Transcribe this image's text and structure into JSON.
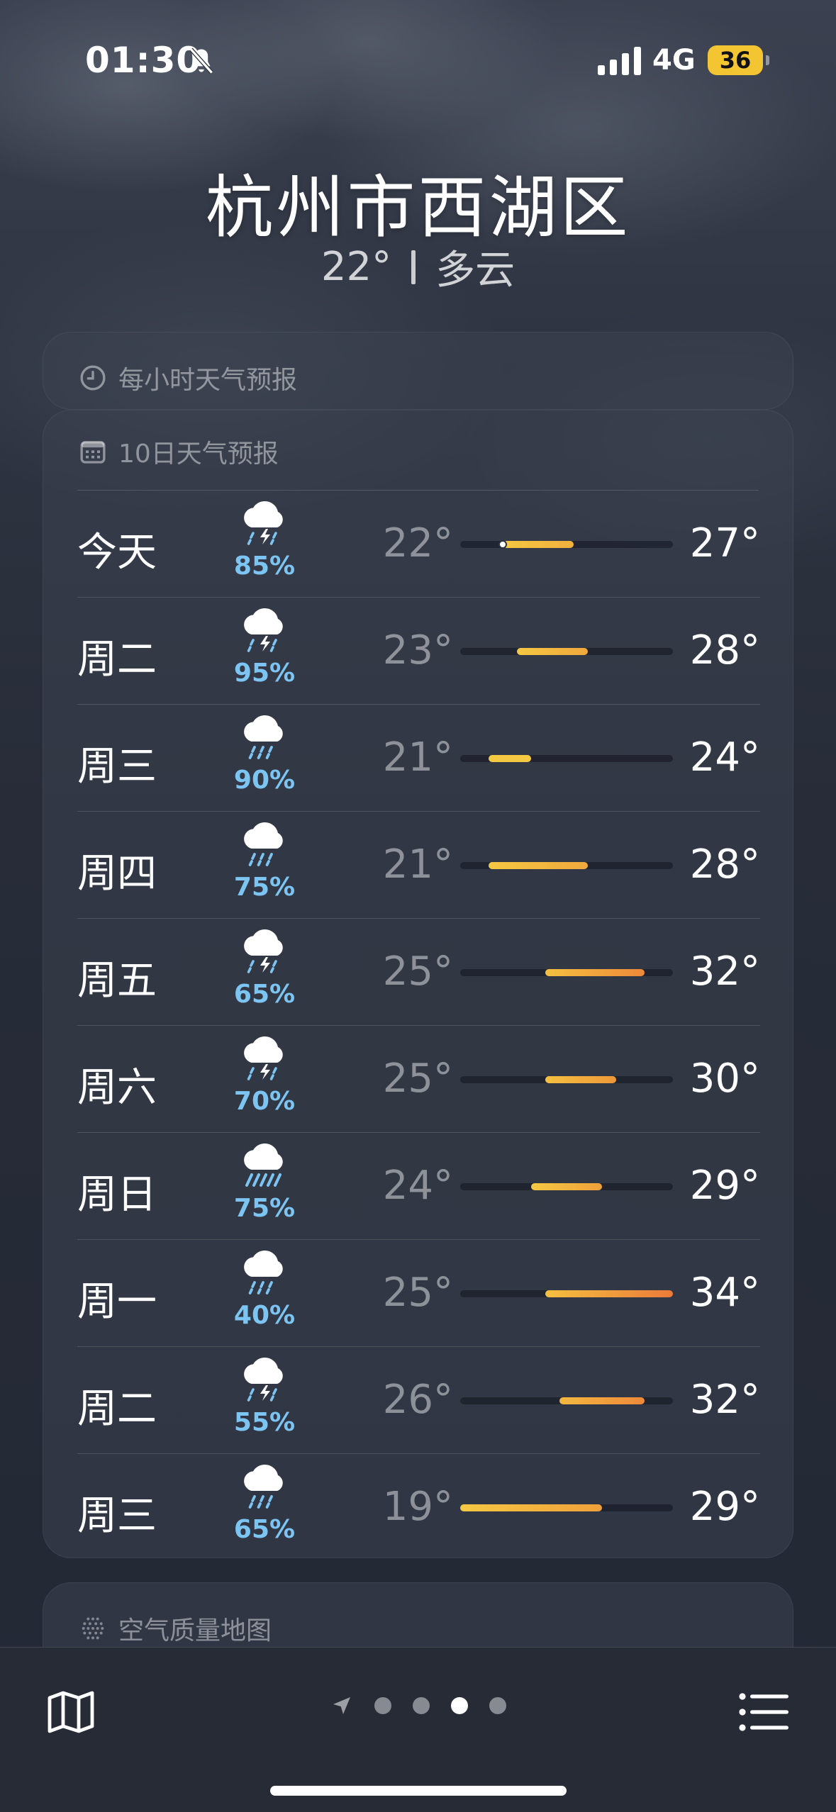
{
  "status": {
    "time": "01:30",
    "network": "4G",
    "battery": "36"
  },
  "header": {
    "city": "杭州市西湖区",
    "temp": "22°",
    "condition": "多云"
  },
  "hourly": {
    "label": "每小时天气预报"
  },
  "daily": {
    "label": "10日天气预报",
    "range_min": 19,
    "range_max": 34,
    "current_temp": 22,
    "days": [
      {
        "day": "今天",
        "icon": "thunderstorm-icon",
        "precip": "85%",
        "low": "22°",
        "high": "27°",
        "lo": 22,
        "hi": 27,
        "today": true
      },
      {
        "day": "周二",
        "icon": "thunderstorm-icon",
        "precip": "95%",
        "low": "23°",
        "high": "28°",
        "lo": 23,
        "hi": 28
      },
      {
        "day": "周三",
        "icon": "rain-icon",
        "precip": "90%",
        "low": "21°",
        "high": "24°",
        "lo": 21,
        "hi": 24
      },
      {
        "day": "周四",
        "icon": "rain-icon",
        "precip": "75%",
        "low": "21°",
        "high": "28°",
        "lo": 21,
        "hi": 28
      },
      {
        "day": "周五",
        "icon": "thunderstorm-icon",
        "precip": "65%",
        "low": "25°",
        "high": "32°",
        "lo": 25,
        "hi": 32
      },
      {
        "day": "周六",
        "icon": "thunderstorm-icon",
        "precip": "70%",
        "low": "25°",
        "high": "30°",
        "lo": 25,
        "hi": 30
      },
      {
        "day": "周日",
        "icon": "heavy-rain-icon",
        "precip": "75%",
        "low": "24°",
        "high": "29°",
        "lo": 24,
        "hi": 29
      },
      {
        "day": "周一",
        "icon": "rain-icon",
        "precip": "40%",
        "low": "25°",
        "high": "34°",
        "lo": 25,
        "hi": 34
      },
      {
        "day": "周二",
        "icon": "thunderstorm-icon",
        "precip": "55%",
        "low": "26°",
        "high": "32°",
        "lo": 26,
        "hi": 32
      },
      {
        "day": "周三",
        "icon": "rain-icon",
        "precip": "65%",
        "low": "19°",
        "high": "29°",
        "lo": 19,
        "hi": 29
      }
    ]
  },
  "air_quality": {
    "label": "空气质量地图"
  },
  "pager": {
    "page_count": 4,
    "active_page": 3
  },
  "colors": {
    "precip": "#7cc4f2",
    "warm_yellow": "#f5c842",
    "warm_orange": "#f0a03a",
    "hot_orange": "#ec7a3a"
  }
}
